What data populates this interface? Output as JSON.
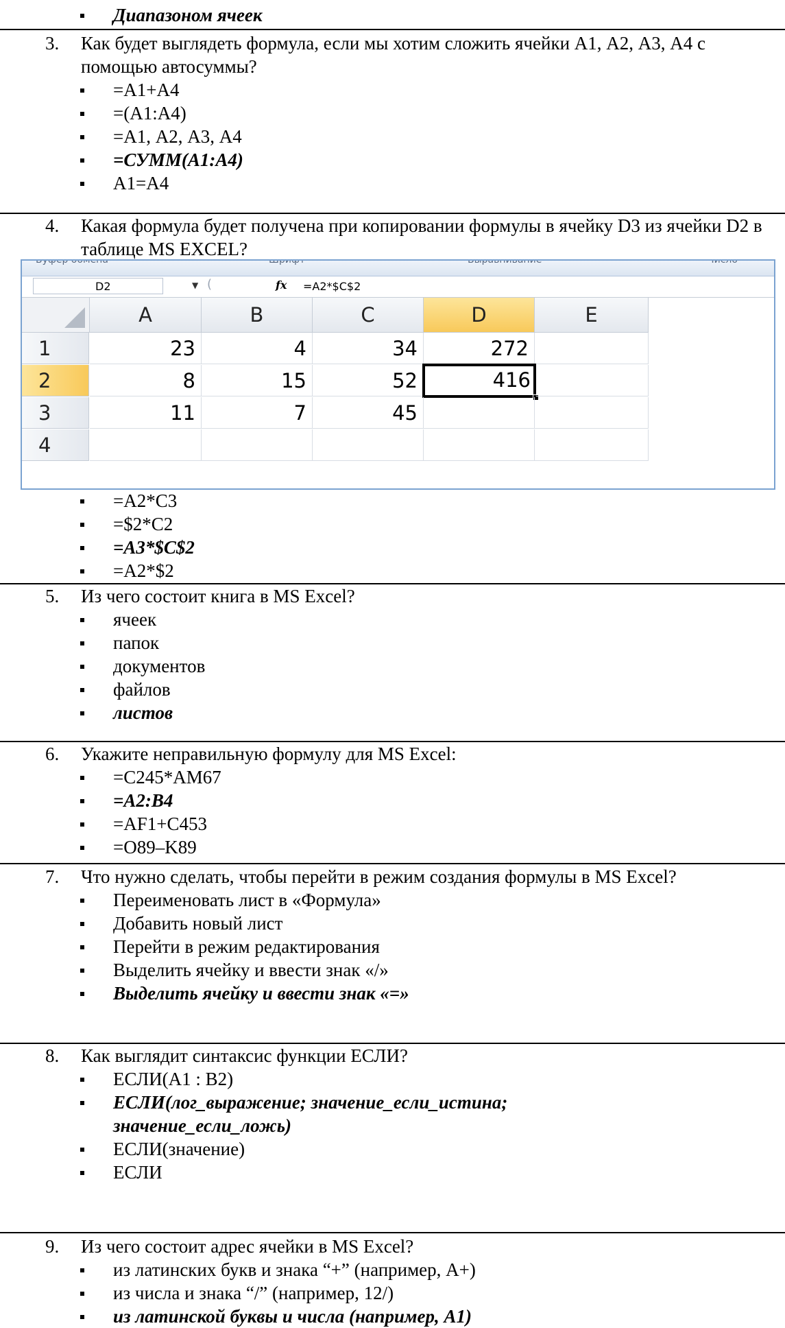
{
  "prev_option": "Диапазоном ячеек",
  "q3": {
    "num": "3.",
    "text": "Как будет выглядеть формула, если мы хотим сложить ячейки А1, А2, А3, А4 с помощью автосуммы?",
    "options": [
      "=А1+А4",
      "=(А1:А4)",
      "=А1, А2, А3, А4",
      "=СУММ(А1:А4)",
      "А1=А4"
    ],
    "answer_index": 3
  },
  "q4": {
    "num": "4.",
    "text": "Какая формула будет получена при копировании формулы в ячейку D3 из ячейки D2 в таблице MS EXCEL?",
    "options": [
      "=A2*C3",
      "=$2*C2",
      "=A3*$C$2",
      "=A2*$2"
    ],
    "answer_index": 2
  },
  "excel": {
    "ribbon_fragments": [
      "Буфер обмена",
      "Шрифт",
      "Выравнивание",
      "Число"
    ],
    "name_box": "D2",
    "fx_label": "fx",
    "formula": "=A2*$C$2",
    "columns": [
      "A",
      "B",
      "C",
      "D",
      "E"
    ],
    "rows": [
      "1",
      "2",
      "3",
      "4"
    ],
    "cells": [
      [
        "23",
        "4",
        "34",
        "272",
        ""
      ],
      [
        "8",
        "15",
        "52",
        "416",
        ""
      ],
      [
        "11",
        "7",
        "45",
        "",
        ""
      ],
      [
        "",
        "",
        "",
        "",
        ""
      ]
    ],
    "active_cell": "D2"
  },
  "q5": {
    "num": "5.",
    "text": "Из чего состоит книга в MS Excel?",
    "options": [
      "ячеек",
      "папок",
      "документов",
      "файлов",
      "листов"
    ],
    "answer_index": 4
  },
  "q6": {
    "num": "6.",
    "text": "Укажите неправильную формулу для MS Excel:",
    "options": [
      "=C245*AM67",
      "=A2:B4",
      "=AF1+C453",
      "=O89–K89"
    ],
    "answer_index": 1
  },
  "q7": {
    "num": "7.",
    "text": "Что нужно сделать, чтобы перейти в режим создания формулы в MS Excel?",
    "options": [
      "Переименовать лист в «Формула»",
      "Добавить новый лист",
      "Перейти в режим редактирования",
      "Выделить ячейку и ввести знак «/»",
      "Выделить ячейку и ввести знак «=»"
    ],
    "answer_index": 4
  },
  "q8": {
    "num": "8.",
    "text": "Как выглядит синтаксис функции ЕСЛИ?",
    "options": [
      "ЕСЛИ(А1 : В2)",
      "ЕСЛИ(лог_выражение; значение_если_истина; значение_если_ложь)",
      "ЕСЛИ(значение)",
      "ЕСЛИ"
    ],
    "answer_index": 1
  },
  "q9": {
    "num": "9.",
    "text": "Из чего состоит адрес ячейки в MS Excel?",
    "options": [
      "из латинских букв и знака “+” (например, A+)",
      "из числа и знака “/” (например, 12/)",
      "из латинской буквы и числа (например, A1)"
    ],
    "answer_index": 2
  }
}
